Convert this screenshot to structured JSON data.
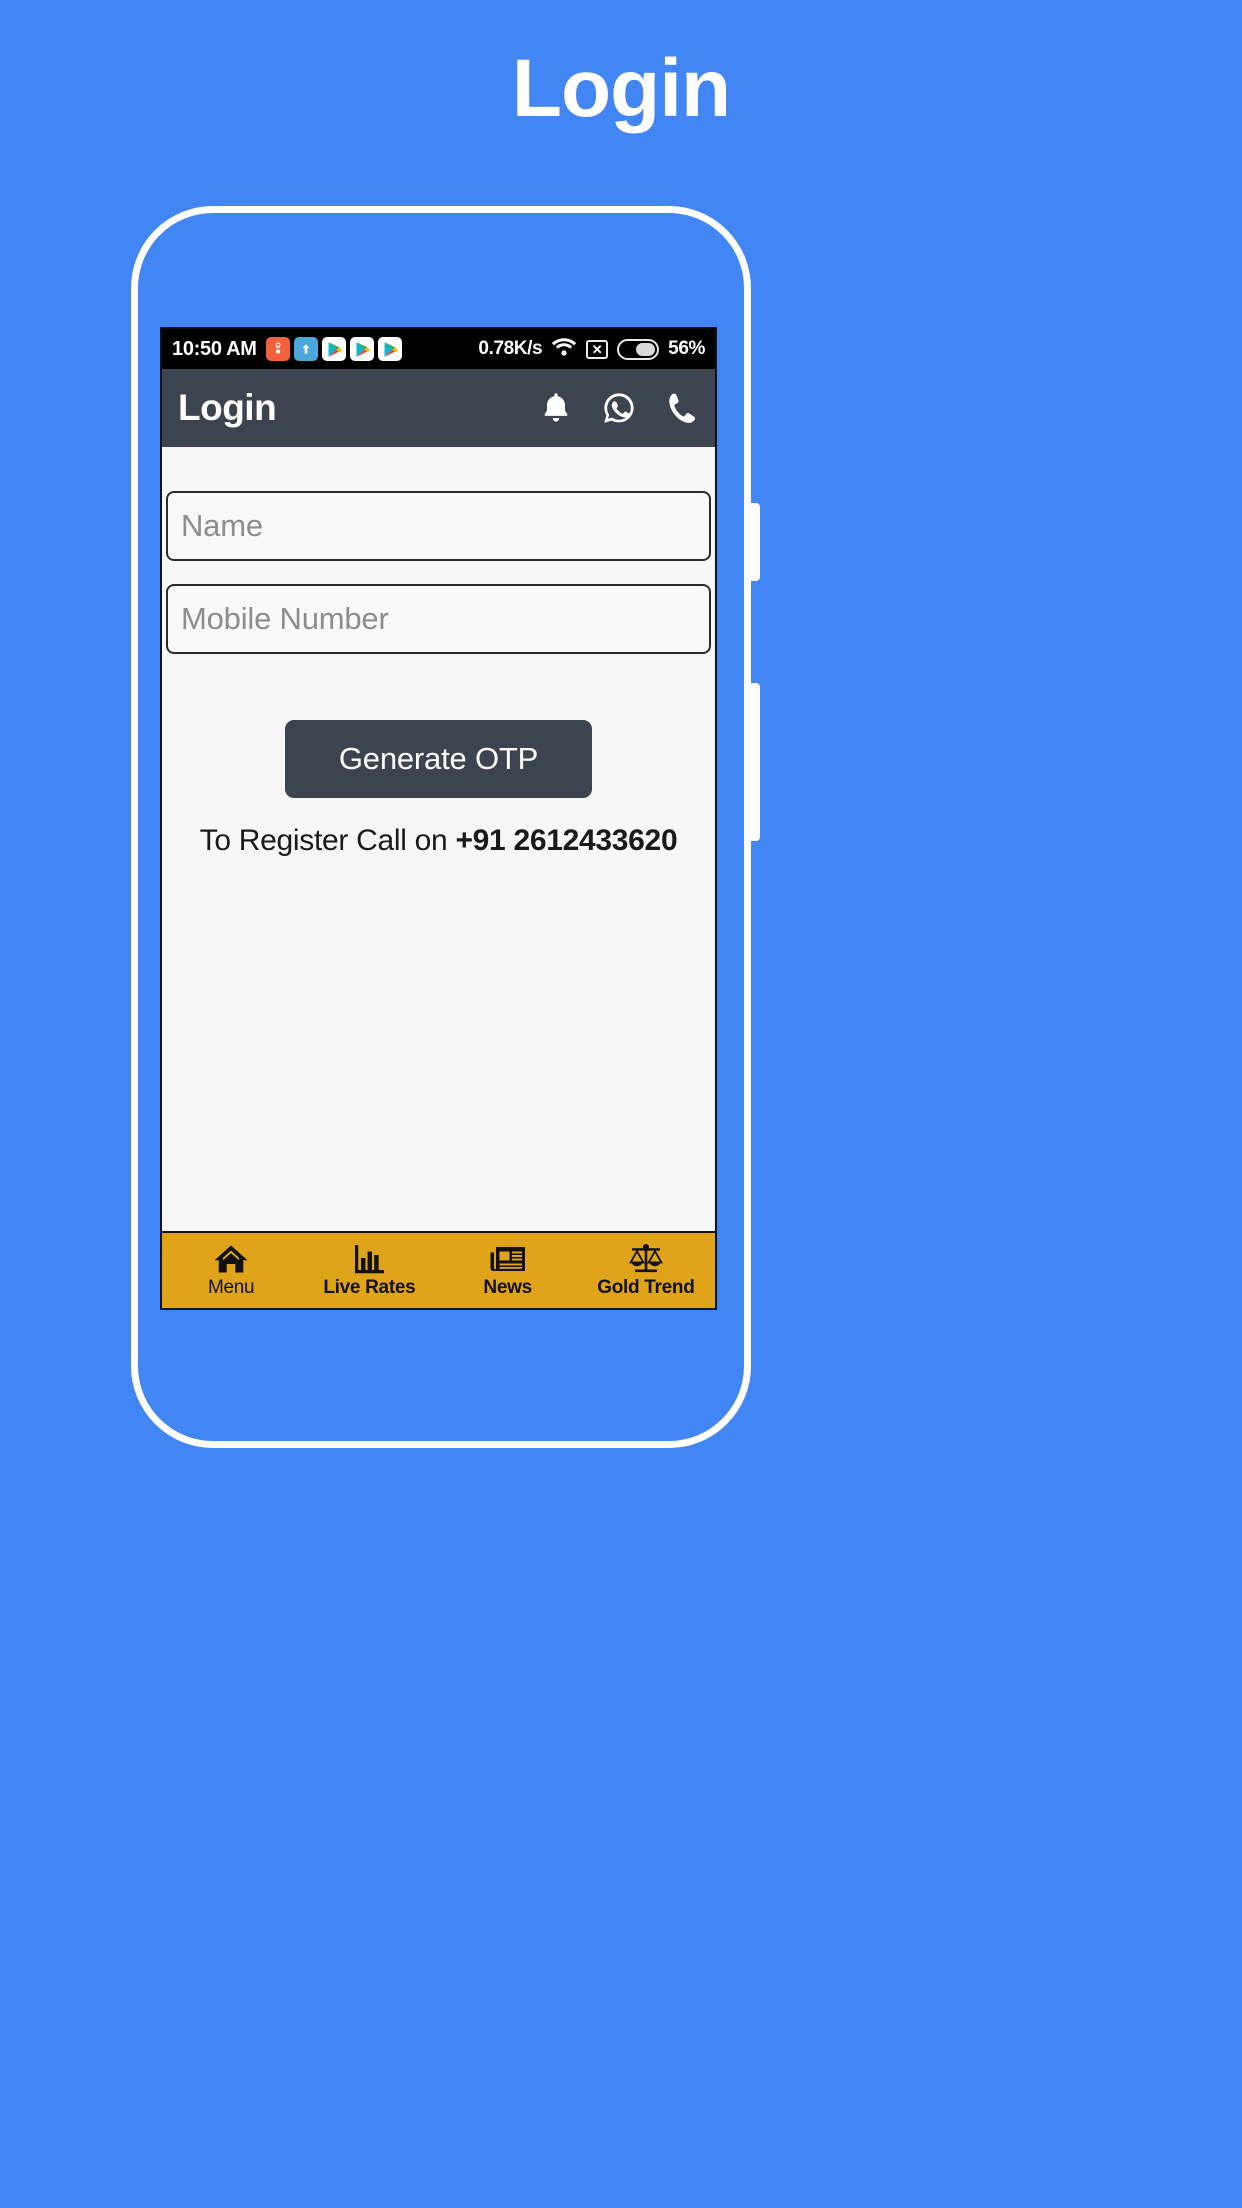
{
  "page": {
    "heading": "Login",
    "background_color": "#4285F4"
  },
  "status_bar": {
    "time": "10:50 AM",
    "network_speed": "0.78K/s",
    "battery_percent": "56%",
    "battery_level": 56,
    "notification_icons": [
      "shopping-notification-icon",
      "upload-notification-icon",
      "play-store-icon",
      "play-store-icon",
      "play-store-icon"
    ],
    "right_icons": [
      "wifi-icon",
      "sim-disabled-icon",
      "battery-icon"
    ]
  },
  "app_bar": {
    "title": "Login",
    "background_color": "#3c4450",
    "actions": [
      {
        "name": "notification-bell-icon",
        "label": "Notifications"
      },
      {
        "name": "whatsapp-icon",
        "label": "WhatsApp"
      },
      {
        "name": "phone-call-icon",
        "label": "Call"
      }
    ]
  },
  "form": {
    "name_field": {
      "placeholder": "Name",
      "value": ""
    },
    "mobile_field": {
      "placeholder": "Mobile Number",
      "value": ""
    },
    "generate_otp_label": "Generate OTP",
    "register_prefix": "To Register Call on ",
    "register_phone": "+91 2612433620"
  },
  "bottom_nav": {
    "background_color": "#e0a41a",
    "items": [
      {
        "label": "Menu",
        "icon": "home-icon"
      },
      {
        "label": "Live Rates",
        "icon": "bar-chart-icon"
      },
      {
        "label": "News",
        "icon": "newspaper-icon"
      },
      {
        "label": "Gold Trend",
        "icon": "balance-scales-icon"
      }
    ]
  }
}
